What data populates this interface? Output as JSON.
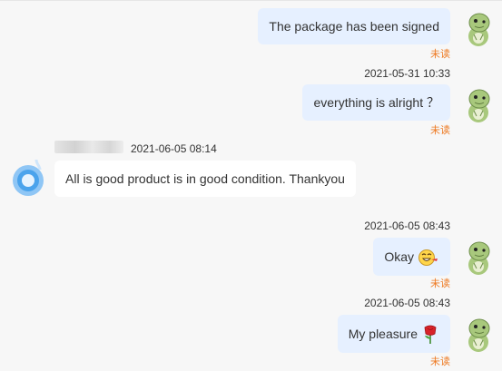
{
  "messages": [
    {
      "id": 1,
      "text": "The package has been signed",
      "status": "未读"
    },
    {
      "id": 2,
      "time": "2021-05-31 10:33",
      "text": "everything is alright ？",
      "status": "未读"
    },
    {
      "id": 3,
      "time": "2021-06-05 08:14",
      "text": "All is good product is in good condition. Thankyou"
    },
    {
      "id": 4,
      "time": "2021-06-05 08:43",
      "text": "Okay",
      "emoji": "grinning-face-emoji",
      "status": "未读"
    },
    {
      "id": 5,
      "time": "2021-06-05 08:43",
      "text": "My pleasure",
      "emoji": "rose-emoji",
      "status": "未读"
    }
  ],
  "colors": {
    "my_bubble": "#e6f0ff",
    "their_bubble": "#ffffff",
    "unread": "#ee7a22",
    "background": "#f7f7f7"
  },
  "icons": {
    "self_avatar": "green-dinosaur-avatar",
    "other_avatar": "blue-water-drop-avatar"
  }
}
